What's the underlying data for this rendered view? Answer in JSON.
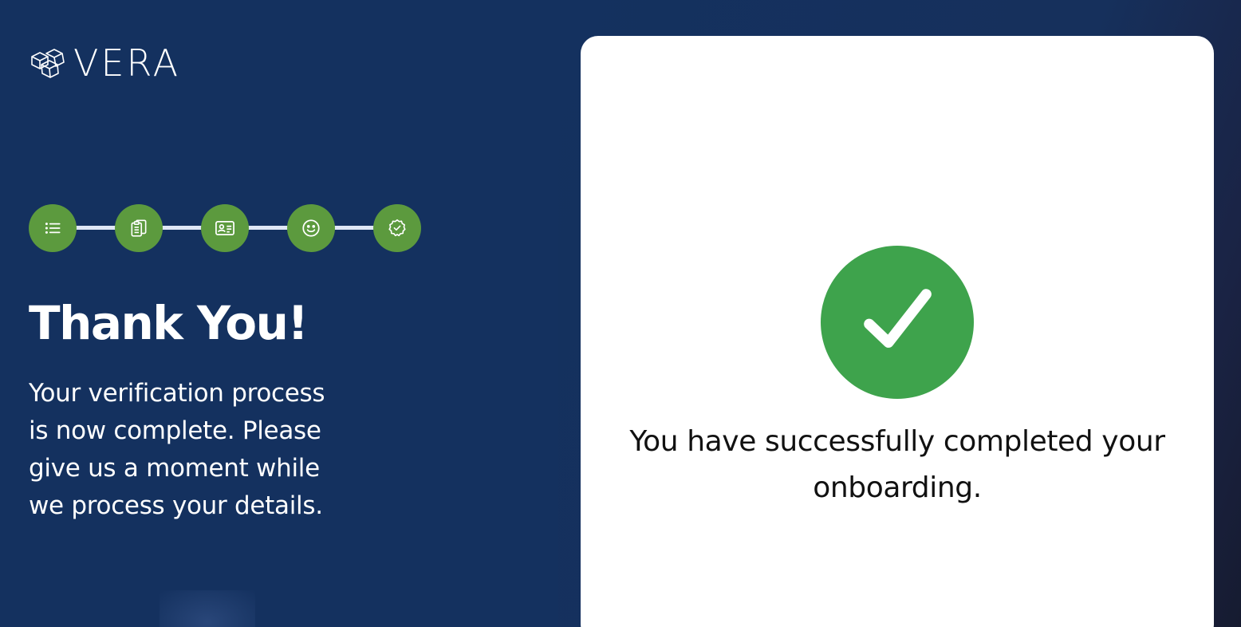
{
  "brand": {
    "name": "VERA",
    "logo_icon": "cubes-logo-icon"
  },
  "stepper": {
    "steps": [
      {
        "icon": "list-icon",
        "status": "complete"
      },
      {
        "icon": "clipboard-icon",
        "status": "complete"
      },
      {
        "icon": "id-card-icon",
        "status": "complete"
      },
      {
        "icon": "smile-icon",
        "status": "complete"
      },
      {
        "icon": "verified-badge-icon",
        "status": "complete"
      }
    ],
    "step_color": "#5c9a3e",
    "connector_color": "#dfe7f5"
  },
  "left_panel": {
    "title": "Thank You!",
    "description": "Your verification process is now complete. Please give us a moment while we process your details.",
    "background_color": "#14315f"
  },
  "card": {
    "status_icon": "checkmark-icon",
    "status_color": "#3ea34c",
    "message": "You have successfully completed your onboarding."
  }
}
